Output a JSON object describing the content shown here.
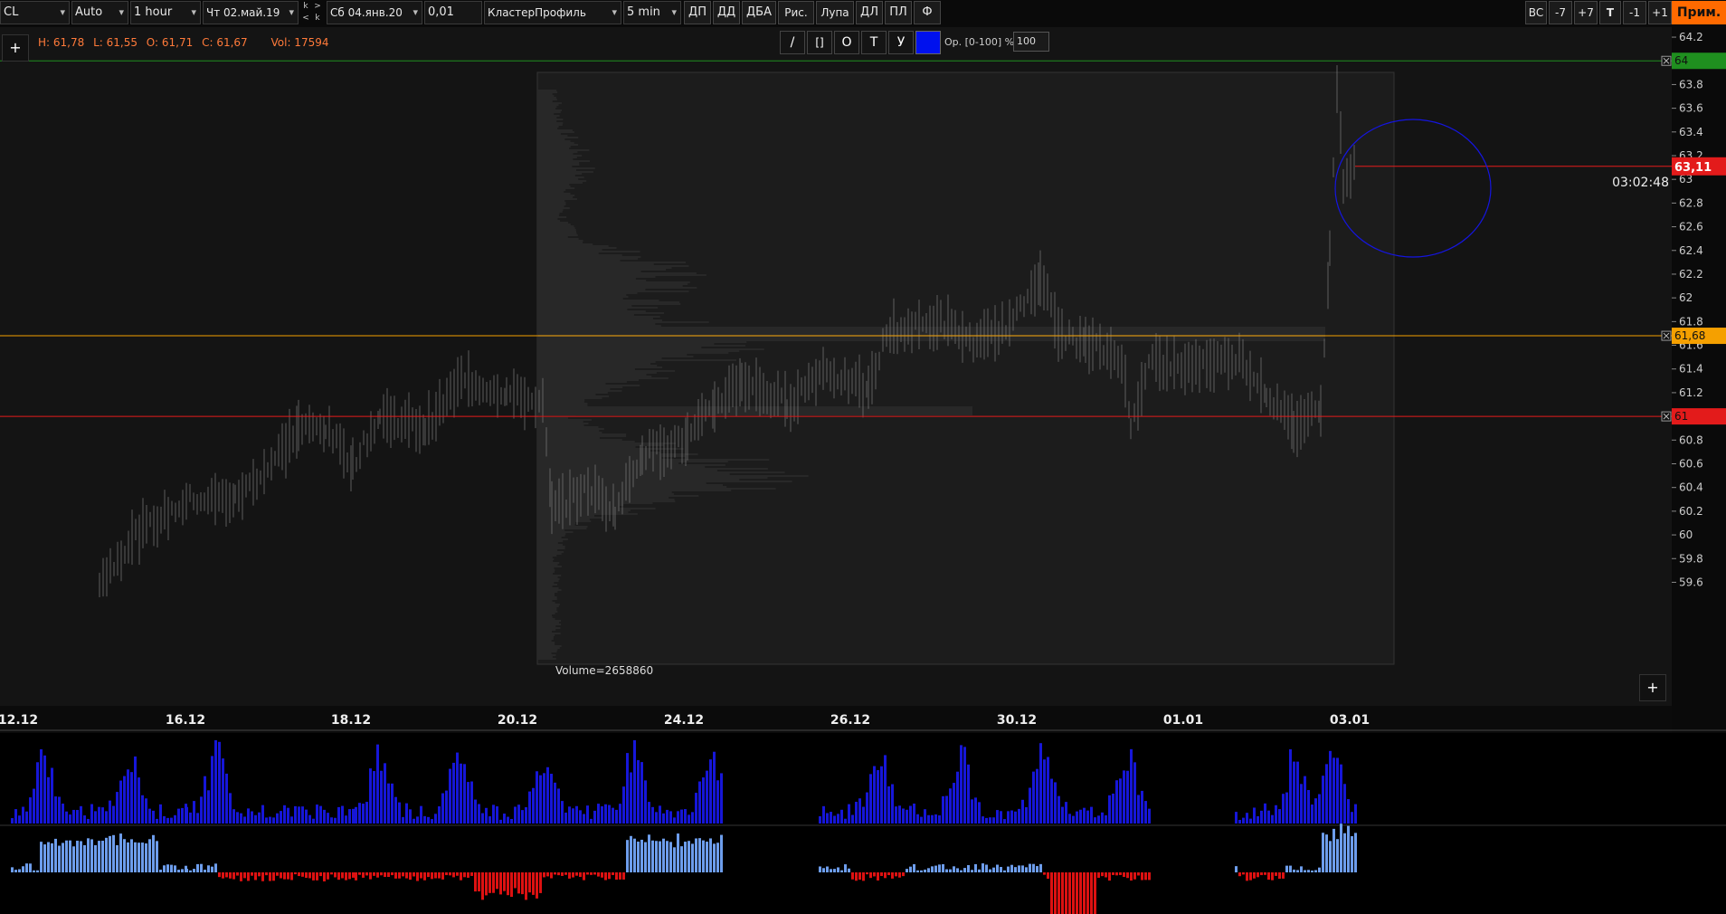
{
  "toolbar": {
    "symbol": "CL",
    "mode": "Auto",
    "timeframe": "1 hour",
    "date_from": "Чт 02.май.19",
    "date_to": "Сб 04.янв.20",
    "tick": "0,01",
    "indicator": "КластерПрофиль",
    "interval": "5 min",
    "buttons": [
      "ДП",
      "ДД",
      "ДБА",
      "Рис.",
      "Лупа",
      "ДЛ",
      "ПЛ",
      "Ф"
    ],
    "right_buttons": [
      "BC",
      "-7",
      "+7",
      "T",
      "-1",
      "+1"
    ],
    "prim_label": "Прим.",
    "nav_arrows": [
      "k",
      ">",
      "<",
      "k"
    ]
  },
  "ohlc_bar": {
    "h": "H: 61,78",
    "l": "L: 61,55",
    "o": "O: 61,71",
    "c": "C: 61,67",
    "vol": "Vol: 17594"
  },
  "draw_tools": {
    "buttons": [
      "/",
      "[]",
      "O",
      "T",
      "У"
    ],
    "swatch_color": "#0011ee",
    "opacity_label": "Op. [0-100] %:",
    "opacity_value": "100"
  },
  "plus_label": "+",
  "price_axis": {
    "ticks": [
      "64.2",
      "63.8",
      "63.6",
      "63.4",
      "63.2",
      "63",
      "62.8",
      "62.6",
      "62.4",
      "62.2",
      "62",
      "61.8",
      "61.6",
      "61.4",
      "61.2",
      "60.8",
      "60.6",
      "60.4",
      "60.2",
      "60",
      "59.8",
      "59.6"
    ],
    "min": 59.55,
    "max": 64.25
  },
  "date_axis": [
    "12.12",
    "16.12",
    "18.12",
    "20.12",
    "24.12",
    "26.12",
    "30.12",
    "01.01",
    "03.01"
  ],
  "levels": [
    {
      "label": "64",
      "price": 64.0,
      "color": "#1f8f1f"
    },
    {
      "label": "61,68",
      "price": 61.68,
      "color": "#f5a000"
    },
    {
      "label": "61",
      "price": 61.0,
      "color": "#e31b1b"
    }
  ],
  "current_price": {
    "label": "63,11",
    "price": 63.11,
    "color": "#e31b1b"
  },
  "timer": "03:02:48",
  "volume_label": "Volume=2658860",
  "accent_blue": "#1616d8",
  "delta_pos_color": "#6d9dec",
  "delta_neg_color": "#dd1111"
}
